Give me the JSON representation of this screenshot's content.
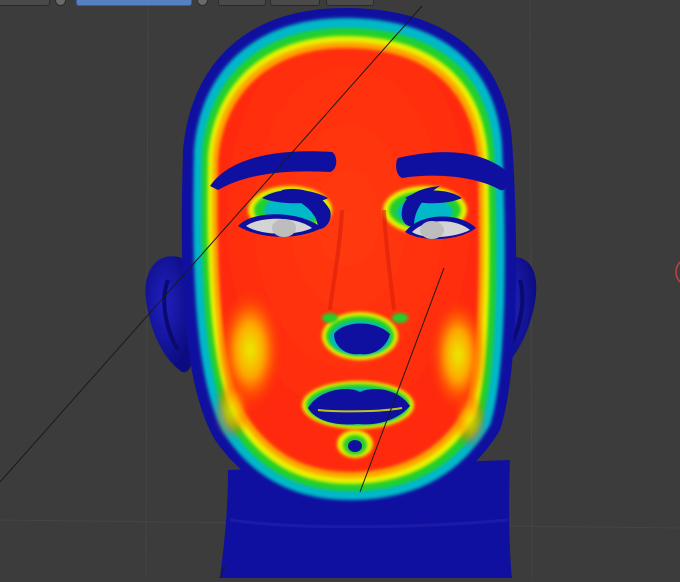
{
  "viewport": {
    "mode": "weight-paint",
    "background_color": "#3c3c3c",
    "grid_color": "#454545",
    "colors": {
      "red": "#ff2a10",
      "orange": "#ffa400",
      "yellow": "#e8f000",
      "green": "#22d02a",
      "cyan": "#00b8c8",
      "blue": "#1010a0",
      "eye": "#d4d4d4"
    }
  },
  "header": {
    "widgets": [
      "",
      "",
      "",
      "",
      ""
    ],
    "icons": [
      "settings-icon",
      "settings-icon"
    ]
  },
  "gizmo": {
    "icon": "rotation-gizmo-icon"
  }
}
